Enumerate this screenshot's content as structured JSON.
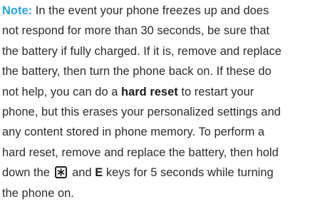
{
  "note": {
    "label": "Note:",
    "lines": [
      " In the event your phone freezes up and does",
      "not respond for more than 30 seconds, be sure that",
      "the battery if fully charged. If it is, remove and replace",
      "the battery, then turn the phone back on. If these do"
    ],
    "line5_pre": "not help, you can do a ",
    "line5_bold": "hard reset",
    "line5_post": " to restart your",
    "lines_b": [
      "phone, but this erases your personalized settings and",
      "any content stored in phone memory. To perform a",
      "hard reset, remove and replace the battery, then hold"
    ],
    "line9_pre": "down the ",
    "key_icon": "star-key-icon",
    "line9_mid": " and ",
    "line9_bold": "E",
    "line9_post": " keys for 5 seconds while turning",
    "line10": "the phone on."
  },
  "colors": {
    "note_label": "#2aa4dc",
    "text": "#2b2b2b"
  }
}
